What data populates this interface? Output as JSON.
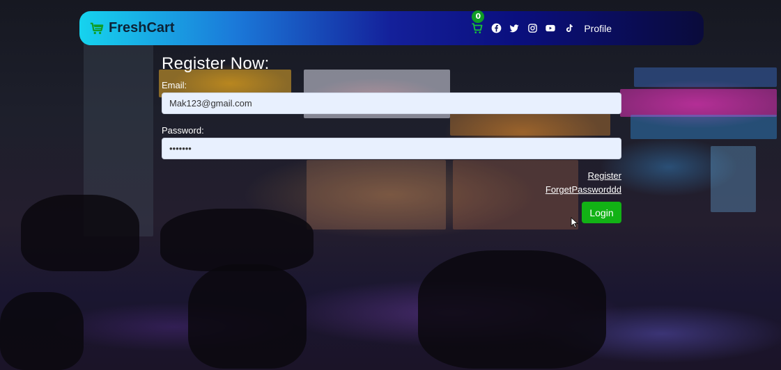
{
  "navbar": {
    "brand": "FreshCart",
    "cart_count": "0",
    "profile_label": "Profile",
    "icons": [
      "cart-icon",
      "facebook-icon",
      "twitter-icon",
      "instagram-icon",
      "youtube-icon",
      "tiktok-icon"
    ],
    "accent": "#16d3ee"
  },
  "form": {
    "title": "Register Now:",
    "email_label": "Email:",
    "email_value": "Mak123@gmail.com",
    "password_label": "Password:",
    "password_value": "1234567",
    "register_link": "Register",
    "forget_link": "ForgetPassworddd",
    "login_button": "Login"
  },
  "colors": {
    "login_button": "#12b215",
    "input_bg": "#e8f0fe"
  }
}
